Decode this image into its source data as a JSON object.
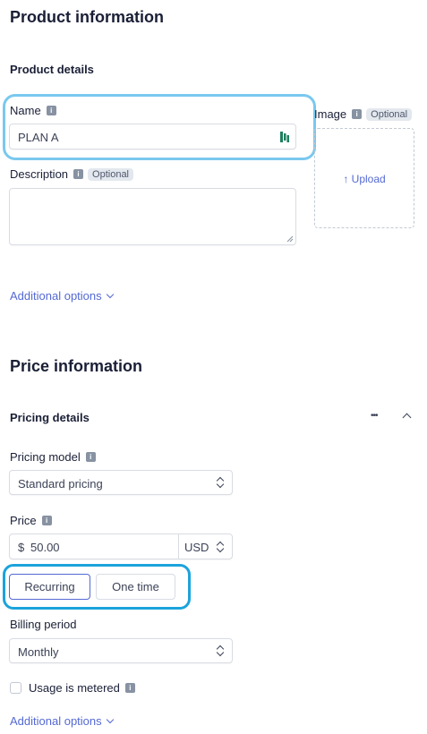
{
  "product": {
    "title": "Product information",
    "details_heading": "Product details",
    "name_label": "Name",
    "name_value": "PLAN A",
    "description_label": "Description",
    "optional_badge": "Optional",
    "image_label": "Image",
    "upload_label": "Upload",
    "additional_options": "Additional options"
  },
  "price": {
    "title": "Price information",
    "details_heading": "Pricing details",
    "more_icon": "•••",
    "pricing_model_label": "Pricing model",
    "pricing_model_value": "Standard pricing",
    "price_label": "Price",
    "currency_symbol": "$",
    "price_value": "50.00",
    "currency_value": "USD",
    "type_options": [
      "Recurring",
      "One time"
    ],
    "type_selected": "Recurring",
    "billing_period_label": "Billing period",
    "billing_period_value": "Monthly",
    "usage_metered_label": "Usage is metered",
    "usage_metered_checked": false,
    "additional_options": "Additional options"
  },
  "colors": {
    "accent": "#5469d4",
    "highlight_light": "#7ac8ef",
    "highlight_dark": "#1ca3dc"
  },
  "icons": {
    "info": "info-icon",
    "upload": "arrow-up-icon",
    "chevron_down": "chevron-down-icon",
    "chevron_up": "chevron-up-icon",
    "more": "ellipsis-icon",
    "select": "up-down-chevrons-icon",
    "password_manager": "password-manager-icon"
  }
}
